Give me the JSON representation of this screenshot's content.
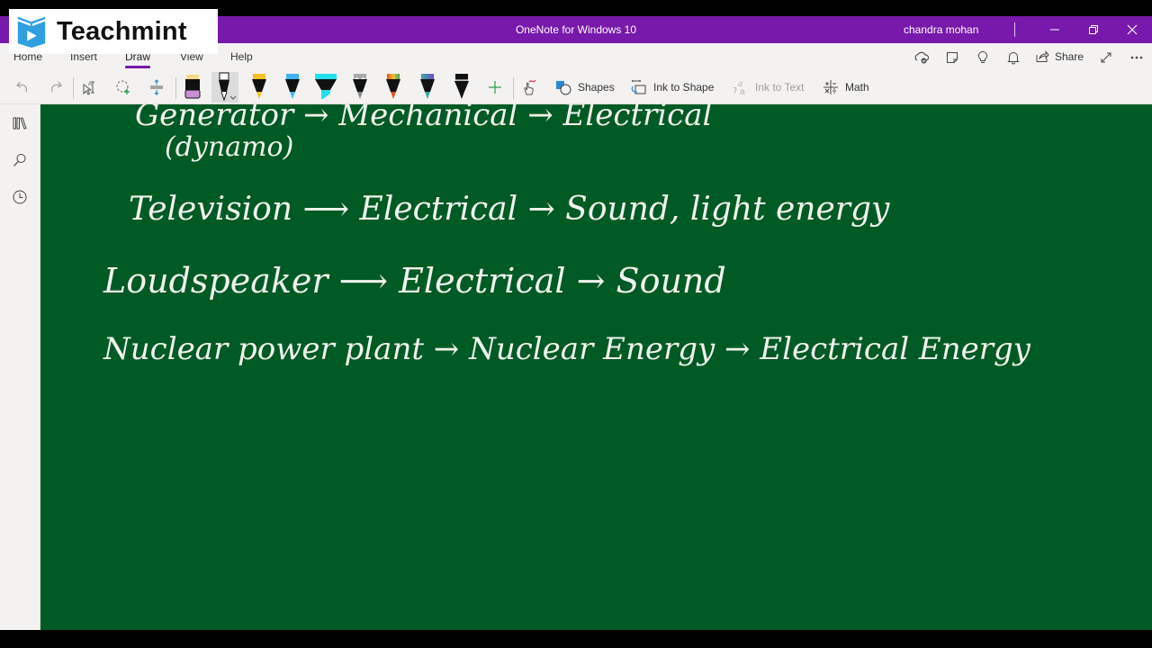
{
  "window": {
    "title": "OneNote for Windows 10",
    "user": "chandra mohan",
    "controls": [
      "minimize",
      "restore",
      "close"
    ]
  },
  "watermark": {
    "brand": "Teachmint"
  },
  "ribbon": {
    "tabs": [
      {
        "label": "Home",
        "active": false
      },
      {
        "label": "Insert",
        "active": false
      },
      {
        "label": "Draw",
        "active": true
      },
      {
        "label": "View",
        "active": false
      },
      {
        "label": "Help",
        "active": false
      }
    ],
    "right_icons": [
      "sync-status-icon",
      "sticky-notes-icon",
      "lightbulb-icon",
      "notifications-icon"
    ],
    "share_label": "Share"
  },
  "toolbar": {
    "undo": "undo-icon",
    "redo": "redo-icon",
    "pens": [
      {
        "name": "eraser",
        "colors": [
          "#f5d88a",
          "#111111",
          "#c98fd6"
        ]
      },
      {
        "name": "black-pen",
        "colors": [
          "#ffffff",
          "#111111"
        ],
        "selected": true
      },
      {
        "name": "yellow-pen",
        "colors": [
          "#f6c026",
          "#111111"
        ]
      },
      {
        "name": "blue-pen",
        "colors": [
          "#3fb6f0",
          "#111111"
        ]
      },
      {
        "name": "cyan-highlighter",
        "colors": [
          "#22e0ee",
          "#111111"
        ]
      },
      {
        "name": "galaxy-pen",
        "colors": [
          "#aaaaaa",
          "#111111"
        ]
      },
      {
        "name": "rainbow-pen",
        "colors": [
          "#e8502a",
          "#111111"
        ]
      },
      {
        "name": "ocean-pen",
        "colors": [
          "#3aa7a5",
          "#111111"
        ]
      },
      {
        "name": "black-marker",
        "colors": [
          "#111111",
          "#111111"
        ]
      }
    ],
    "shapes_label": "Shapes",
    "ink_to_shape_label": "Ink to Shape",
    "ink_to_text_label": "Ink to Text",
    "math_label": "Math"
  },
  "sidebar": {
    "items": [
      "notebooks-icon",
      "search-icon",
      "recent-icon"
    ]
  },
  "page": {
    "background": "#005a24",
    "ink_lines": [
      {
        "text": "Generator  →  Mechanical  →  Electrical"
      },
      {
        "text": "(dynamo)"
      },
      {
        "text": "Television  ⟶  Electrical →  Sound, light energy"
      },
      {
        "text": "Loudspeaker  ⟶  Electrical  →  Sound"
      },
      {
        "text": "Nuclear power plant → Nuclear Energy → Electrical Energy"
      }
    ]
  }
}
